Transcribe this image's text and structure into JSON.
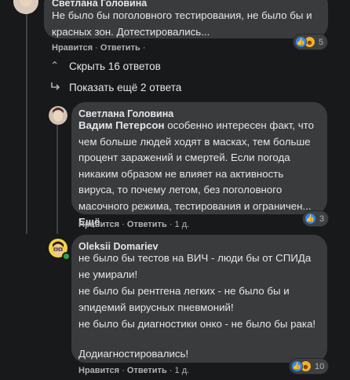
{
  "comment1": {
    "author": "Светлана Головина",
    "text": "Не было бы поголовного тестирования, не было бы и красных зон. Дотестировались...",
    "actions": {
      "like": "Нравится",
      "reply": "Ответить"
    },
    "reactions": {
      "count": "5",
      "icons": [
        "like-icon",
        "haha-icon"
      ]
    }
  },
  "toggles": {
    "hide": "Скрыть 16 ответов",
    "show_more": "Показать ещё 2 ответа"
  },
  "comment2": {
    "author": "Светлана Головина",
    "tag": "Вадим Петерсон",
    "text": " особенно интересен факт, что чем больше людей ходят в масках, тем больше процент заражений и смертей. Если погода никаким образом не влияет на активность вируса, то почему летом, без поголовного масочного режима, тестирования и ограничен...",
    "more": "Ещё",
    "actions": {
      "like": "Нравится",
      "reply": "Ответить",
      "time": "1 д."
    },
    "reactions": {
      "count": "3",
      "icons": [
        "like-icon"
      ]
    }
  },
  "comment3": {
    "author": "Oleksii Domariev",
    "paragraphs": [
      "не было бы тестов на ВИЧ - люди бы от СПИДа не умирали!",
      "не было бы рентгена легких - не было бы и эпидемий вирусных пневмоний!",
      "не было бы диагностики онко - не было бы рака!",
      "Додиагностировались!"
    ],
    "actions": {
      "like": "Нравится",
      "reply": "Ответить",
      "time": "1 д."
    },
    "reactions": {
      "count": "10",
      "icons": [
        "like-icon",
        "haha-icon"
      ]
    }
  }
}
